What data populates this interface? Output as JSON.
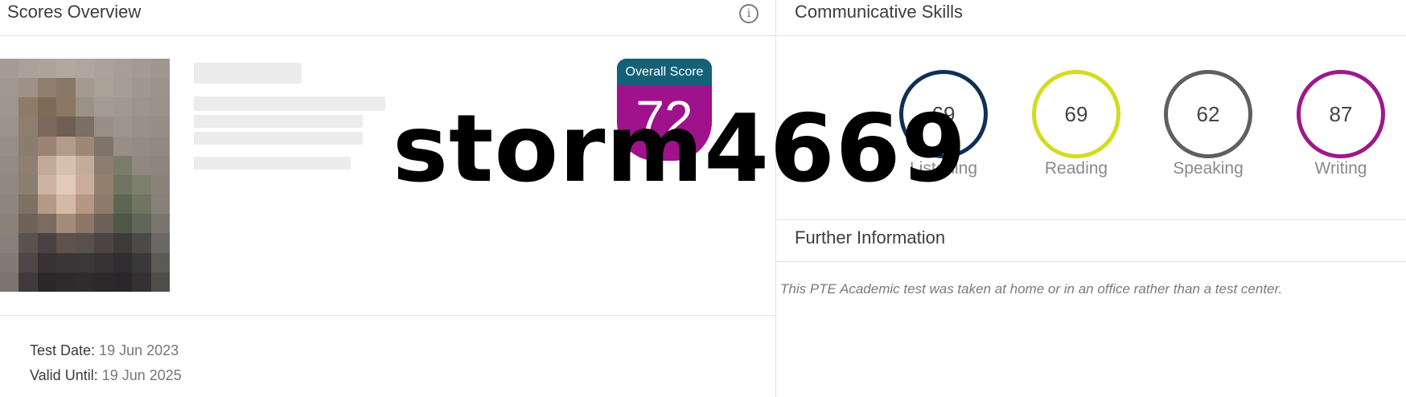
{
  "left_panel": {
    "title": "Scores Overview",
    "icon": "info-icon",
    "overall_score": {
      "label": "Overall Score",
      "value": "72"
    },
    "test_date": {
      "label": "Test Date:",
      "value": "19 Jun 2023"
    },
    "valid_until": {
      "label": "Valid Until:",
      "value": "19 Jun 2025"
    }
  },
  "communicative_skills": {
    "title": "Communicative Skills",
    "skills": [
      {
        "label": "Listening",
        "score": "69",
        "color": "#0f2f57"
      },
      {
        "label": "Reading",
        "score": "69",
        "color": "#d2dc1f"
      },
      {
        "label": "Speaking",
        "score": "62",
        "color": "#5f5f5f"
      },
      {
        "label": "Writing",
        "score": "87",
        "color": "#9c1a8a"
      }
    ]
  },
  "further_information": {
    "title": "Further Information",
    "note": "This PTE Academic test was taken at home or in an office rather than a test center."
  },
  "watermark": "storm4669",
  "colors": {
    "badge_header": "#136177",
    "badge_body": "#a0128c"
  }
}
